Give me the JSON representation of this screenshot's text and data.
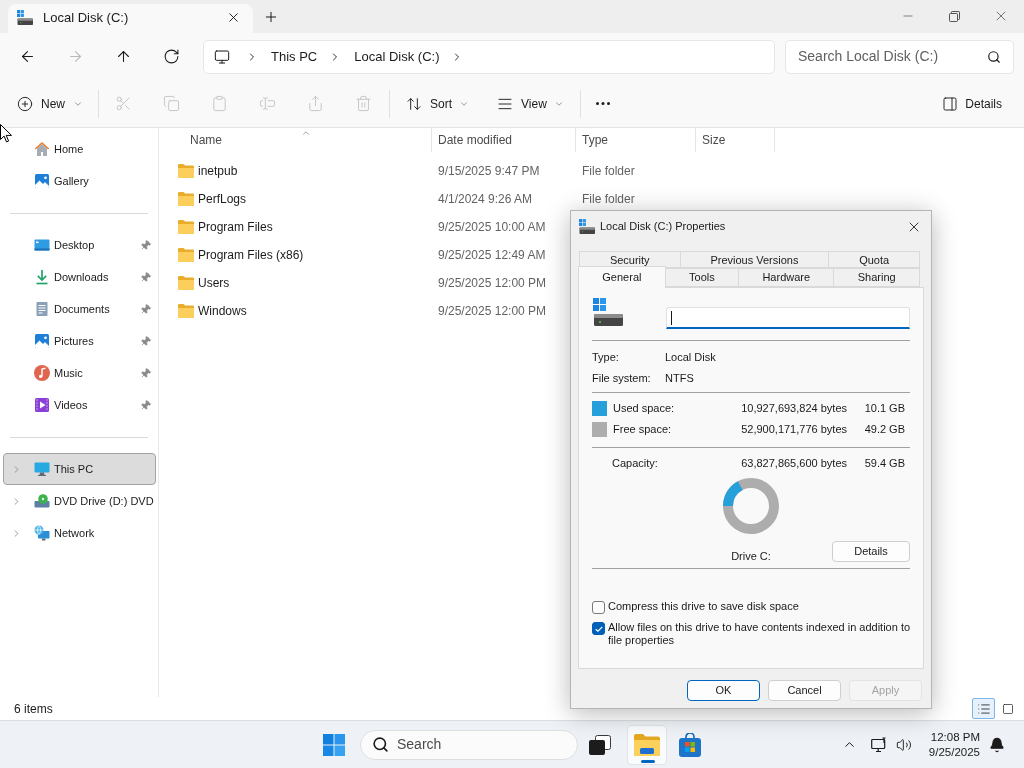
{
  "window": {
    "tab": {
      "title": "Local Disk (C:)"
    }
  },
  "navigation": [
    {
      "kind": "back",
      "disabled": false
    },
    {
      "kind": "forward",
      "disabled": true
    },
    {
      "kind": "up",
      "disabled": false
    },
    {
      "kind": "refresh",
      "disabled": false
    }
  ],
  "breadcrumbs": [
    "This PC",
    "Local Disk (C:)"
  ],
  "search": {
    "placeholder": "Search Local Disk (C:)"
  },
  "toolbar": {
    "new": {
      "label": "New"
    },
    "actions": [
      {
        "kind": "cut",
        "disabled": true
      },
      {
        "kind": "copy",
        "disabled": true
      },
      {
        "kind": "paste",
        "disabled": true
      },
      {
        "kind": "rename",
        "disabled": true
      },
      {
        "kind": "share",
        "disabled": true
      },
      {
        "kind": "delete",
        "disabled": true
      }
    ],
    "menus": [
      {
        "kind": "sort",
        "label": "Sort"
      },
      {
        "kind": "view",
        "label": "View"
      }
    ],
    "details": {
      "label": "Details"
    }
  },
  "sidebar": {
    "quick_access": [
      {
        "kind": "home",
        "label": "Home",
        "selected": false
      },
      {
        "kind": "gallery",
        "label": "Gallery",
        "selected": false
      }
    ],
    "pinned": [
      {
        "kind": "desktop",
        "label": "Desktop",
        "selected": false,
        "pinned": true
      },
      {
        "kind": "downloads",
        "label": "Downloads",
        "selected": false,
        "pinned": true
      },
      {
        "kind": "documents",
        "label": "Documents",
        "selected": false,
        "pinned": true
      },
      {
        "kind": "pictures",
        "label": "Pictures",
        "selected": false,
        "pinned": true
      },
      {
        "kind": "music",
        "label": "Music",
        "selected": false,
        "pinned": true
      },
      {
        "kind": "videos",
        "label": "Videos",
        "selected": false,
        "pinned": true
      }
    ],
    "locations": [
      {
        "kind": "this_pc",
        "label": "This PC",
        "selected": true,
        "expanded": false
      },
      {
        "kind": "dvd_drive",
        "label": "DVD Drive (D:) DVD",
        "selected": false,
        "expanded": false
      },
      {
        "kind": "network",
        "label": "Network",
        "selected": false,
        "expanded": false
      }
    ]
  },
  "file_list": {
    "columns": [
      {
        "label": "Name",
        "sorted": true
      },
      {
        "label": "Date modified",
        "sorted": false
      },
      {
        "label": "Type",
        "sorted": false
      },
      {
        "label": "Size",
        "sorted": false
      }
    ],
    "rows": [
      {
        "name": "inetpub",
        "date_modified": "9/15/2025 9:47 PM",
        "type": "File folder",
        "selected": false
      },
      {
        "name": "PerfLogs",
        "date_modified": "4/1/2024 9:26 AM",
        "type": "File folder",
        "selected": false
      },
      {
        "name": "Program Files",
        "date_modified": "9/25/2025 10:00 AM",
        "selected": false
      },
      {
        "name": "Program Files (x86)",
        "date_modified": "9/25/2025 12:49 AM",
        "selected": false
      },
      {
        "name": "Users",
        "date_modified": "9/25/2025 12:00 PM",
        "selected": false
      },
      {
        "name": "Windows",
        "date_modified": "9/25/2025 12:00 PM",
        "selected": false
      }
    ]
  },
  "status_bar": {
    "item_count": "6 items",
    "views": [
      {
        "kind": "details",
        "selected": true
      },
      {
        "kind": "tiles",
        "selected": false
      }
    ]
  },
  "properties_dialog": {
    "title": "Local Disk (C:) Properties",
    "tab_rows": [
      [
        {
          "label": "Security",
          "selected": false
        },
        {
          "label": "Previous Versions",
          "selected": false
        },
        {
          "label": "Quota",
          "selected": false
        }
      ],
      [
        {
          "label": "General",
          "selected": true
        },
        {
          "label": "Tools",
          "selected": false
        },
        {
          "label": "Hardware",
          "selected": false
        },
        {
          "label": "Sharing",
          "selected": false
        }
      ]
    ],
    "name_field": {
      "focused": true
    },
    "info": [
      {
        "label": "Type:",
        "value": "Local Disk"
      },
      {
        "label": "File system:",
        "value": "NTFS"
      }
    ],
    "space": [
      {
        "label": "Used space:",
        "bytes": "10,927,693,824 bytes",
        "size": "10.1 GB",
        "color": "#26a0da"
      },
      {
        "label": "Free space:",
        "bytes": "52,900,171,776 bytes",
        "size": "49.2 GB",
        "color": "#adadad"
      }
    ],
    "capacity": {
      "label": "Capacity:",
      "bytes": "63,827,865,600 bytes",
      "size": "59.4 GB"
    },
    "drive_label": "Drive C:",
    "details_button": {
      "label": "Details"
    },
    "options": [
      {
        "label": "Compress this drive to save disk space",
        "checked": false
      },
      {
        "label": "Allow files on this drive to have contents indexed in addition to file properties",
        "checked": true
      }
    ],
    "buttons": [
      {
        "label": "OK",
        "default": true,
        "disabled": false
      },
      {
        "label": "Cancel",
        "default": false,
        "disabled": false
      },
      {
        "label": "Apply",
        "default": false,
        "disabled": true
      }
    ]
  },
  "taskbar": {
    "search": {
      "placeholder": "Search"
    },
    "apps": [
      {
        "kind": "task_view",
        "active": false
      },
      {
        "kind": "file_explorer",
        "active": true
      },
      {
        "kind": "store",
        "active": false
      }
    ],
    "clock": {
      "time": "12:08 PM",
      "date": "9/25/2025"
    }
  }
}
